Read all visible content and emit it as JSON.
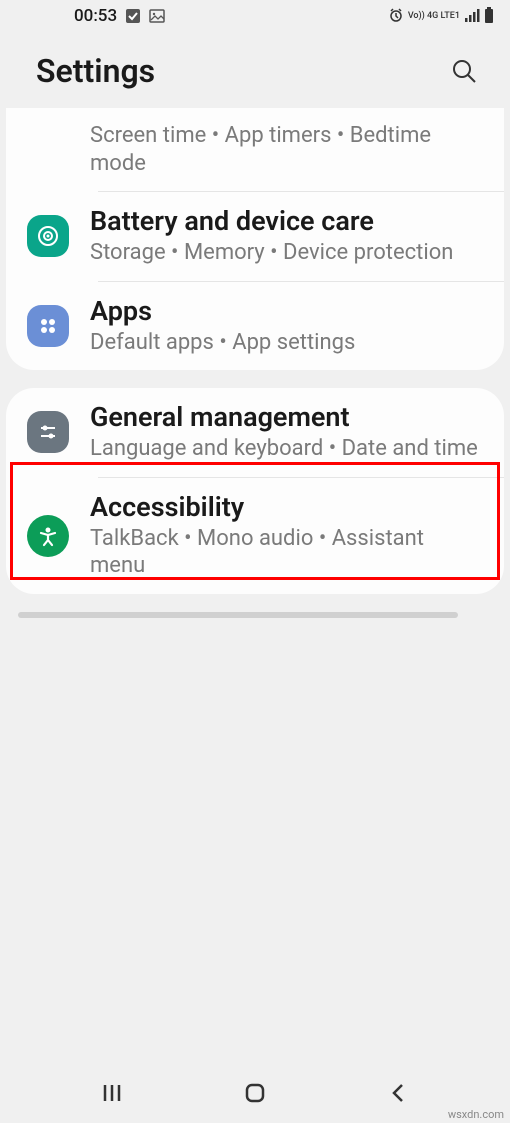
{
  "status": {
    "time": "00:53",
    "network_label": "Vo)) 4G LTE1"
  },
  "header": {
    "title": "Settings"
  },
  "groups": [
    {
      "rows": [
        {
          "icon": null,
          "title": "",
          "sub": "Screen time  •  App timers  •  Bedtime mode"
        },
        {
          "icon": "device-care",
          "icon_color": "#0aa58a",
          "title": "Battery and device care",
          "sub": "Storage  •  Memory  •  Device protection"
        },
        {
          "icon": "apps",
          "icon_color": "#6b8fd6",
          "title": "Apps",
          "sub": "Default apps  •  App settings",
          "highlighted": true
        }
      ]
    },
    {
      "rows": [
        {
          "icon": "general",
          "icon_color": "#6b7680",
          "title": "General management",
          "sub": "Language and keyboard  •  Date and time"
        },
        {
          "icon": "accessibility",
          "icon_color": "#0c9d58",
          "title": "Accessibility",
          "sub": "TalkBack  •  Mono audio  •  Assistant menu"
        }
      ]
    }
  ],
  "watermark": "wsxdn.com"
}
